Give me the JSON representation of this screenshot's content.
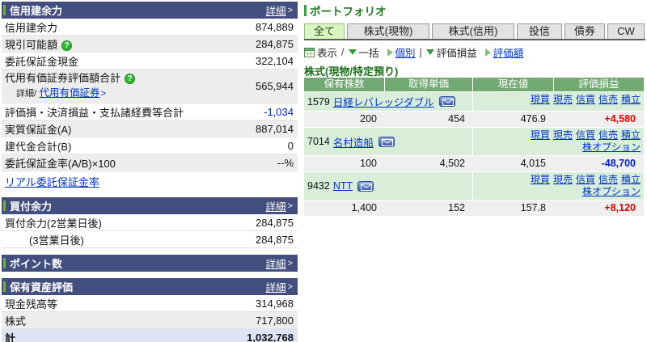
{
  "colors": {
    "panel_header_bg": "#424e7e",
    "panel_header_accent": "#6ab32c",
    "portfolio_green": "#1f7a1f",
    "table_header_bg": "#72a972",
    "name_row_bg": "#d8eed8",
    "data_row_bg": "#efefef",
    "selected_tab_bg": "#d9f6c2",
    "gain_red": "#e60000",
    "loss_blue": "#0022cc",
    "link_blue": "#0033cc",
    "total_row_bg": "#dee4f5"
  },
  "left": {
    "margin": {
      "title": "信用建余力",
      "detail_label": "詳細",
      "rows": [
        {
          "label": "信用建余力",
          "value": "874,889"
        },
        {
          "label": "現引可能額",
          "value": "284,875"
        },
        {
          "label": "委託保証金現金",
          "value": "322,104"
        },
        {
          "label": "代用有価証券評価額合計",
          "sub_prefix": "詳細/",
          "sub_link": "代用有価証券",
          "value": "565,944"
        },
        {
          "label": "評価損・決済損益・支払諸経費等合計",
          "value": "-1,034",
          "value_class": "val-neg"
        },
        {
          "label": "実質保証金(A)",
          "value": "887,014"
        },
        {
          "label": "建代金合計(B)",
          "value": "0"
        },
        {
          "label": "委託保証金率(A/B)×100",
          "value": "--%"
        }
      ],
      "footer_link": "リアル委託保証金率",
      "help_label": "?"
    },
    "buying_power": {
      "title": "買付余力",
      "detail_label": "詳細",
      "rows": [
        {
          "label": "買付余力(2営業日後)",
          "value": "284,875"
        },
        {
          "label": "(3営業日後)",
          "value": "284,875"
        }
      ]
    },
    "points": {
      "title": "ポイント数",
      "detail_label": "詳細"
    },
    "assets": {
      "title": "保有資産評価",
      "detail_label": "詳細",
      "rows": [
        {
          "label": "現金残高等",
          "value": "314,968"
        },
        {
          "label": "株式",
          "value": "717,800"
        }
      ],
      "total_label": "計",
      "total_value": "1,032,768"
    }
  },
  "portfolio": {
    "title": "ポートフォリオ",
    "tabs": [
      {
        "label": "全て",
        "selected": true
      },
      {
        "label": "株式(現物)",
        "selected": false
      },
      {
        "label": "株式(信用)",
        "selected": false
      },
      {
        "label": "投信",
        "selected": false
      },
      {
        "label": "債券",
        "selected": false
      },
      {
        "label": "CW",
        "selected": false
      }
    ],
    "controls": {
      "view_label": "表示",
      "slash": "/",
      "bulk_label": "一括",
      "individual_label": "個別",
      "pipe": "|",
      "pl_label": "評価損益",
      "value_label": "評価額"
    },
    "section_title": "株式(現物/特定預り)",
    "table": {
      "headers": [
        "保有株数",
        "取得単価",
        "現在値",
        "評価損益"
      ],
      "positions": [
        {
          "code": "1579",
          "name": "日経レバレッジダブル",
          "actions": [
            "現買",
            "現売",
            "信買",
            "信売",
            "積立"
          ],
          "action_line2": "",
          "qty": "200",
          "cost": "454",
          "price": "476.9",
          "pl": "+4,580",
          "pl_class": "pl-pos"
        },
        {
          "code": "7014",
          "name": "名村造船",
          "actions": [
            "現買",
            "現売",
            "信買",
            "信売",
            "積立"
          ],
          "action_line2": "株オプション",
          "qty": "100",
          "cost": "4,502",
          "price": "4,015",
          "pl": "-48,700",
          "pl_class": "pl-neg"
        },
        {
          "code": "9432",
          "name": "NTT",
          "actions": [
            "現買",
            "現売",
            "信買",
            "信売",
            "積立"
          ],
          "action_line2": "株オプション",
          "qty": "1,400",
          "cost": "152",
          "price": "157.8",
          "pl": "+8,120",
          "pl_class": "pl-pos"
        }
      ]
    }
  }
}
